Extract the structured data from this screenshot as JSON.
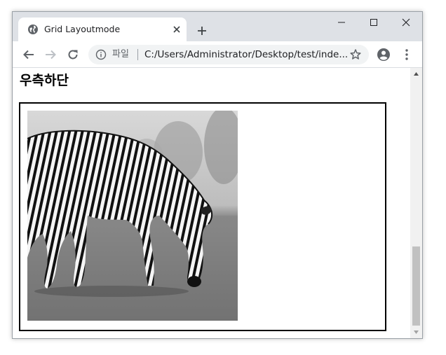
{
  "browser": {
    "tab": {
      "title": "Grid Layoutmode"
    },
    "omnibox": {
      "scheme_label": "파일",
      "url": "C:/Users/Administrator/Desktop/test/inde..."
    }
  },
  "page": {
    "heading": "우측하단",
    "image_alt": "zebra"
  },
  "icons": {
    "favicon": "globe-icon",
    "tab_close": "close-icon",
    "new_tab": "plus-icon",
    "back": "arrow-left-icon",
    "forward": "arrow-right-icon",
    "reload": "reload-icon",
    "info": "info-icon",
    "star": "star-icon",
    "profile": "account-icon",
    "menu": "kebab-menu-icon"
  },
  "colors": {
    "tabstrip": "#dee1e6",
    "omnibox": "#f1f3f4",
    "scrollbar_thumb": "#c1c1c1",
    "box_border": "#000000"
  }
}
